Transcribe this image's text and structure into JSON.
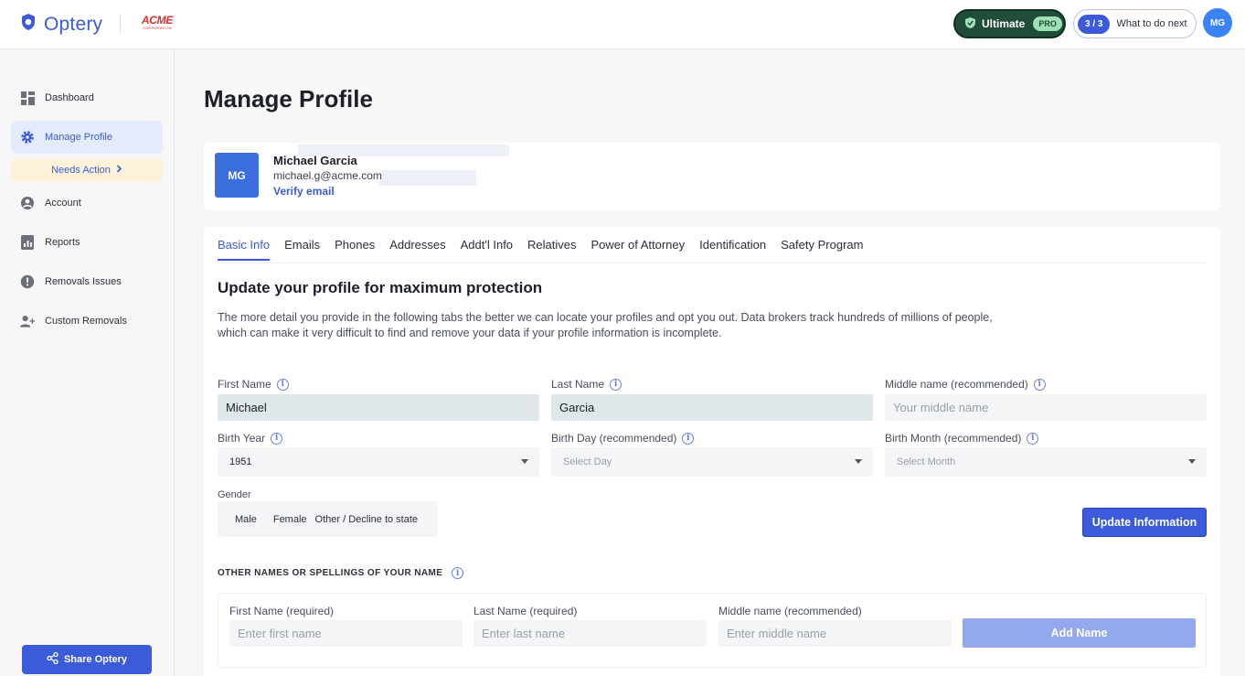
{
  "header": {
    "brand": "Optery",
    "partner_logo": "ACME",
    "partner_logo_sub": "CORPORATION",
    "plan_label": "Ultimate",
    "plan_badge": "PRO",
    "progress_count": "3 / 3",
    "progress_label": "What to do next",
    "avatar_initials": "MG"
  },
  "sidebar": {
    "items": [
      {
        "label": "Dashboard",
        "icon": "grid-icon"
      },
      {
        "label": "Manage Profile",
        "icon": "gear-icon"
      },
      {
        "label": "Account",
        "icon": "user-circle-icon"
      },
      {
        "label": "Reports",
        "icon": "report-icon"
      },
      {
        "label": "Removals Issues",
        "icon": "alert-icon"
      },
      {
        "label": "Custom Removals",
        "icon": "user-plus-icon"
      }
    ],
    "needs_action": "Needs Action",
    "share_label": "Share Optery"
  },
  "page": {
    "title": "Manage Profile"
  },
  "profile": {
    "initials": "MG",
    "name": "Michael Garcia",
    "email": "michael.g@acme.com",
    "verify_label": "Verify email"
  },
  "tabs": [
    "Basic Info",
    "Emails",
    "Phones",
    "Addresses",
    "Addt'l Info",
    "Relatives",
    "Power of Attorney",
    "Identification",
    "Safety Program"
  ],
  "basic_info": {
    "heading": "Update your profile for maximum protection",
    "description": "The more detail you provide in the following tabs the better we can locate your profiles and opt you out. Data brokers track hundreds of millions of people, which can make it very difficult to find and remove your data if your profile information is incomplete.",
    "first_name": {
      "label": "First Name",
      "value": "Michael"
    },
    "last_name": {
      "label": "Last Name",
      "value": "Garcia"
    },
    "middle_name": {
      "label": "Middle name (recommended)",
      "placeholder": "Your middle name"
    },
    "birth_year": {
      "label": "Birth Year",
      "value": "1951"
    },
    "birth_day": {
      "label": "Birth Day (recommended)",
      "placeholder": "Select Day"
    },
    "birth_month": {
      "label": "Birth Month (recommended)",
      "placeholder": "Select Month"
    },
    "gender": {
      "label": "Gender",
      "options": [
        "Male",
        "Female",
        "Other / Decline to state"
      ]
    },
    "update_button": "Update Information"
  },
  "other_names": {
    "title": "OTHER NAMES OR SPELLINGS OF YOUR NAME",
    "first_label": "First Name (required)",
    "first_placeholder": "Enter first name",
    "last_label": "Last Name (required)",
    "last_placeholder": "Enter last name",
    "middle_label": "Middle name (recommended)",
    "middle_placeholder": "Enter middle name",
    "add_button": "Add Name"
  },
  "colors": {
    "accent": "#3b5bdb",
    "plan_bg": "#1f4d3a",
    "needs_action_bg": "#fbf2d9"
  }
}
